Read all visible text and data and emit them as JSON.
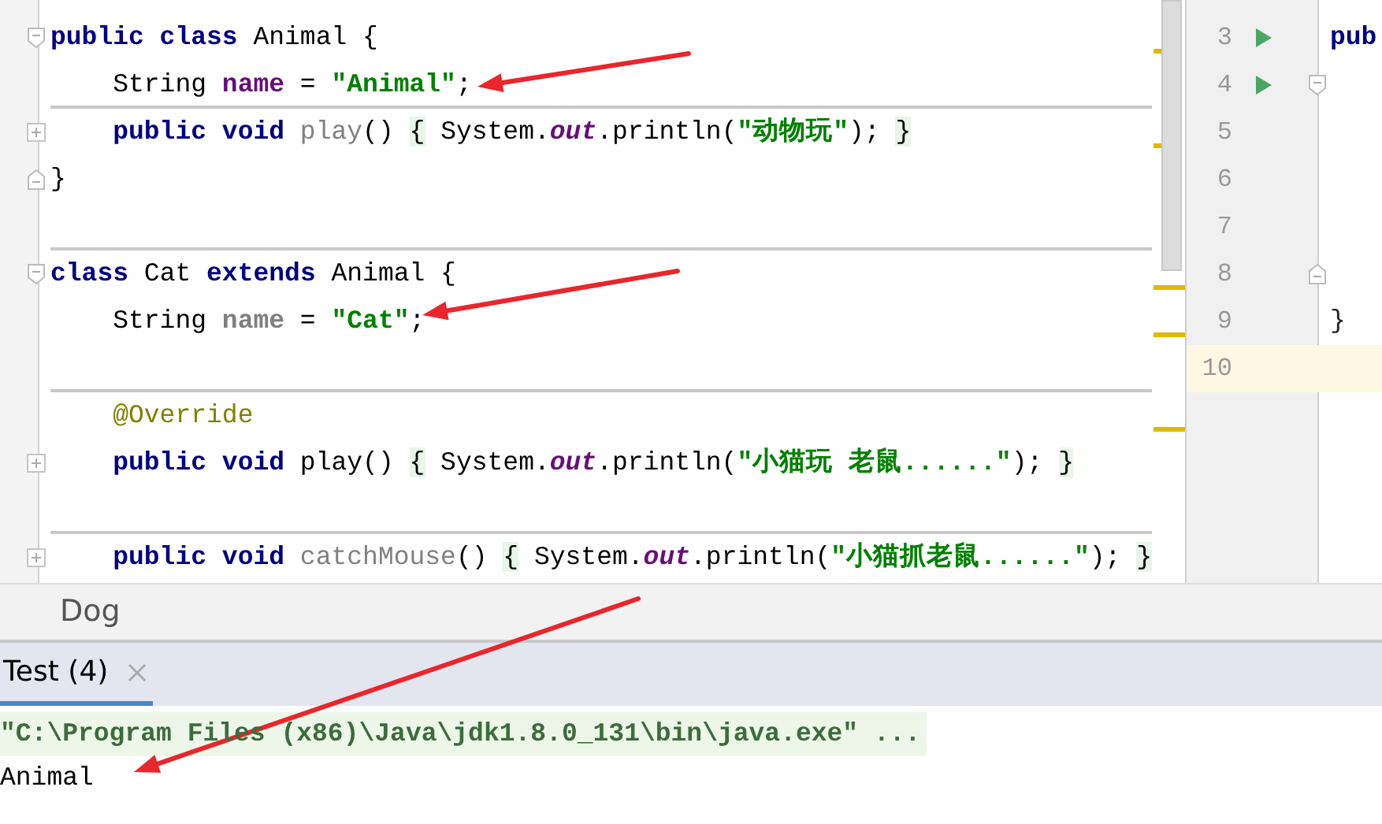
{
  "editor": {
    "lines": [
      {
        "fold_start": true,
        "marker": true,
        "tokens": [
          {
            "text": "public class",
            "kind": "keyword"
          },
          {
            "text": " Animal {",
            "kind": "plain"
          }
        ]
      },
      {
        "separator_below": true,
        "tokens": [
          {
            "text": "    String ",
            "kind": "plain"
          },
          {
            "text": "name",
            "kind": "field"
          },
          {
            "text": " = ",
            "kind": "plain"
          },
          {
            "text": "\"Animal\"",
            "kind": "string"
          },
          {
            "text": ";",
            "kind": "plain"
          }
        ]
      },
      {
        "collapsed": true,
        "marker": true,
        "tokens": [
          {
            "text": "    public void",
            "kind": "keyword"
          },
          {
            "text": " play",
            "kind": "unused"
          },
          {
            "text": "() ",
            "kind": "plain"
          },
          {
            "text": "{",
            "kind": "brace"
          },
          {
            "text": " System.",
            "kind": "plain"
          },
          {
            "text": "out",
            "kind": "static"
          },
          {
            "text": ".println(",
            "kind": "plain"
          },
          {
            "text": "\"动物玩\"",
            "kind": "string"
          },
          {
            "text": "); ",
            "kind": "plain"
          },
          {
            "text": "}",
            "kind": "brace"
          }
        ]
      },
      {
        "fold_end": true,
        "tokens": [
          {
            "text": "}",
            "kind": "plain"
          }
        ]
      },
      {
        "separator_below": true
      },
      {
        "fold_start": true,
        "marker": true,
        "tokens": [
          {
            "text": "class",
            "kind": "keyword"
          },
          {
            "text": " Cat ",
            "kind": "plain"
          },
          {
            "text": "extends",
            "kind": "keyword"
          },
          {
            "text": " Animal {",
            "kind": "plain"
          }
        ]
      },
      {
        "marker": true,
        "tokens": [
          {
            "text": "    String ",
            "kind": "plain"
          },
          {
            "text": "name",
            "kind": "unused-field"
          },
          {
            "text": " = ",
            "kind": "plain"
          },
          {
            "text": "\"Cat\"",
            "kind": "string"
          },
          {
            "text": ";",
            "kind": "plain"
          }
        ]
      },
      {
        "separator_below": true
      },
      {
        "marker": true,
        "tokens": [
          {
            "text": "    @Override",
            "kind": "annotation"
          }
        ]
      },
      {
        "collapsed": true,
        "tokens": [
          {
            "text": "    public void",
            "kind": "keyword"
          },
          {
            "text": " play() ",
            "kind": "plain"
          },
          {
            "text": "{",
            "kind": "brace"
          },
          {
            "text": " System.",
            "kind": "plain"
          },
          {
            "text": "out",
            "kind": "static"
          },
          {
            "text": ".println(",
            "kind": "plain"
          },
          {
            "text": "\"小猫玩 老鼠......\"",
            "kind": "string"
          },
          {
            "text": "); ",
            "kind": "plain"
          },
          {
            "text": "}",
            "kind": "brace"
          }
        ]
      },
      {
        "separator_below": true
      },
      {
        "collapsed": true,
        "tokens": [
          {
            "text": "    public void",
            "kind": "keyword"
          },
          {
            "text": " catchMouse",
            "kind": "unused"
          },
          {
            "text": "() ",
            "kind": "plain"
          },
          {
            "text": "{",
            "kind": "brace"
          },
          {
            "text": " System.",
            "kind": "plain"
          },
          {
            "text": "out",
            "kind": "static"
          },
          {
            "text": ".println(",
            "kind": "plain"
          },
          {
            "text": "\"小猫抓老鼠......\"",
            "kind": "string"
          },
          {
            "text": "); ",
            "kind": "plain"
          },
          {
            "text": "}",
            "kind": "brace"
          }
        ]
      }
    ]
  },
  "side_editor": {
    "lines": [
      {
        "number": "3",
        "run": true,
        "code": "pub",
        "current": false
      },
      {
        "number": "4",
        "run": true,
        "fold_start": true,
        "current": false
      },
      {
        "number": "5",
        "current": false
      },
      {
        "number": "6",
        "current": false
      },
      {
        "number": "7",
        "current": false
      },
      {
        "number": "8",
        "fold_end": true,
        "current": false
      },
      {
        "number": "9",
        "code": "}",
        "current": false
      },
      {
        "number": "10",
        "current": true
      }
    ]
  },
  "breadcrumb": "Dog",
  "run_panel": {
    "tabs": [
      {
        "label": "Test (4)",
        "selected": true
      }
    ],
    "console": [
      {
        "text": "\"C:\\Program Files (x86)\\Java\\jdk1.8.0_131\\bin\\java.exe\" ...",
        "kind": "command"
      },
      {
        "text": "Animal",
        "kind": "output"
      }
    ]
  },
  "annotations": [
    {
      "kind": "arrow"
    },
    {
      "kind": "arrow"
    },
    {
      "kind": "arrow"
    }
  ]
}
